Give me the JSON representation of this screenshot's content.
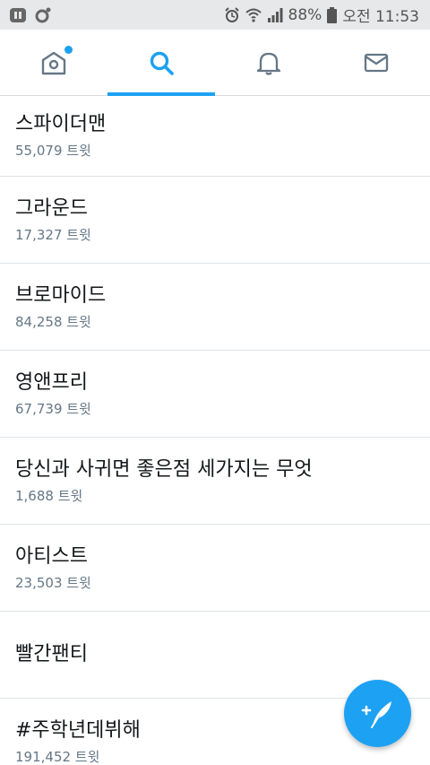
{
  "status_bar": {
    "battery_percent": "88%",
    "time": "오전 11:53",
    "left_icons": [
      "app-notification-icon",
      "circle-notification-icon"
    ],
    "right_icons": [
      "alarm-icon",
      "wifi-icon",
      "signal-icon",
      "battery-icon"
    ]
  },
  "tabs": [
    {
      "name": "home",
      "icon": "home-icon",
      "active": false,
      "has_badge": true
    },
    {
      "name": "search",
      "icon": "search-icon",
      "active": true,
      "has_badge": false
    },
    {
      "name": "notifications",
      "icon": "bell-icon",
      "active": false,
      "has_badge": false
    },
    {
      "name": "messages",
      "icon": "mail-icon",
      "active": false,
      "has_badge": false
    }
  ],
  "trends": [
    {
      "title": "스파이더맨",
      "count": "55,079 트윗"
    },
    {
      "title": "그라운드",
      "count": "17,327 트윗"
    },
    {
      "title": "브로마이드",
      "count": "84,258 트윗"
    },
    {
      "title": "영앤프리",
      "count": "67,739 트윗"
    },
    {
      "title": "당신과 사귀면 좋은점 세가지는 무엇",
      "count": "1,688 트윗"
    },
    {
      "title": "아티스트",
      "count": "23,503 트윗"
    },
    {
      "title": "빨간팬티",
      "count": ""
    },
    {
      "title": "#주학년데뷔해",
      "count": "191,452 트윗"
    }
  ],
  "fab": {
    "icon": "compose-tweet-icon"
  },
  "colors": {
    "accent": "#1da1f2",
    "muted_text": "#657786",
    "divider": "#dfe3e6",
    "status_bar_bg": "#e7e8e9"
  }
}
